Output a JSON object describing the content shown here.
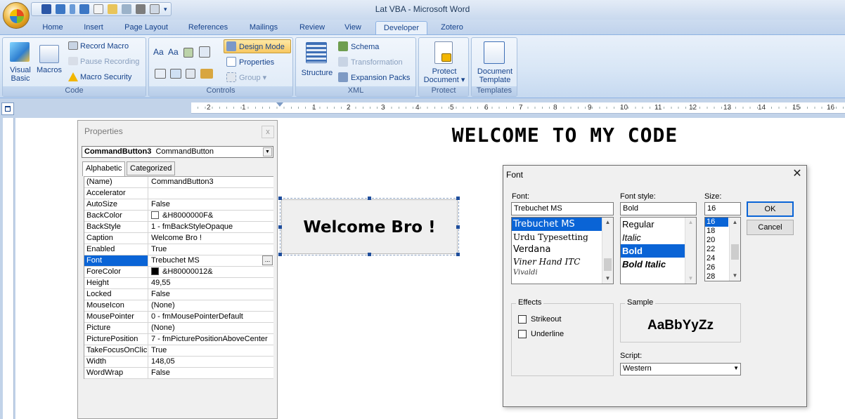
{
  "window": {
    "title": "Lat VBA - Microsoft Word"
  },
  "tabs": [
    "Home",
    "Insert",
    "Page Layout",
    "References",
    "Mailings",
    "Review",
    "View",
    "Developer",
    "Zotero"
  ],
  "active_tab": "Developer",
  "ribbon": {
    "code": {
      "label": "Code",
      "visual_basic": [
        "Visual",
        "Basic"
      ],
      "macros": "Macros",
      "record_macro": "Record Macro",
      "pause_recording": "Pause Recording",
      "macro_security": "Macro Security"
    },
    "controls": {
      "label": "Controls",
      "design_mode": "Design Mode",
      "properties": "Properties",
      "group": "Group"
    },
    "xml": {
      "label": "XML",
      "structure": "Structure",
      "schema": "Schema",
      "transformation": "Transformation",
      "expansion_packs": "Expansion Packs"
    },
    "protect": {
      "label": "Protect",
      "protect_document": [
        "Protect",
        "Document"
      ]
    },
    "templates": {
      "label": "Templates",
      "document_template": [
        "Document",
        "Template"
      ]
    }
  },
  "ruler": {
    "labels": [
      "2",
      "1",
      "1",
      "2",
      "3",
      "4",
      "5",
      "6",
      "7",
      "8",
      "9",
      "10",
      "11",
      "12",
      "13",
      "14",
      "15",
      "16"
    ]
  },
  "properties_panel": {
    "title": "Properties",
    "close": "x",
    "object_name": "CommandButton3",
    "object_type": "CommandButton",
    "tabs": [
      "Alphabetic",
      "Categorized"
    ],
    "active_tab": "Alphabetic",
    "selected_row": "Font",
    "rows": [
      {
        "name": "(Name)",
        "value": "CommandButton3"
      },
      {
        "name": "Accelerator",
        "value": ""
      },
      {
        "name": "AutoSize",
        "value": "False"
      },
      {
        "name": "BackColor",
        "value": "&H8000000F&",
        "swatch": "#ffffff"
      },
      {
        "name": "BackStyle",
        "value": "1 - fmBackStyleOpaque"
      },
      {
        "name": "Caption",
        "value": "Welcome Bro !"
      },
      {
        "name": "Enabled",
        "value": "True"
      },
      {
        "name": "Font",
        "value": "Trebuchet MS"
      },
      {
        "name": "ForeColor",
        "value": "&H80000012&",
        "swatch": "#000000"
      },
      {
        "name": "Height",
        "value": "49,55"
      },
      {
        "name": "Locked",
        "value": "False"
      },
      {
        "name": "MouseIcon",
        "value": "(None)"
      },
      {
        "name": "MousePointer",
        "value": "0 - fmMousePointerDefault"
      },
      {
        "name": "Picture",
        "value": "(None)"
      },
      {
        "name": "PicturePosition",
        "value": "7 - fmPicturePositionAboveCenter"
      },
      {
        "name": "TakeFocusOnClick",
        "value": "True"
      },
      {
        "name": "Width",
        "value": "148,05"
      },
      {
        "name": "WordWrap",
        "value": "False"
      }
    ]
  },
  "document": {
    "heading": "WELCOME TO MY CODE",
    "button_caption": "Welcome Bro !"
  },
  "font_dialog": {
    "title": "Font",
    "font_label": "Font:",
    "font_value": "Trebuchet MS",
    "font_list": [
      "Trebuchet MS",
      "Urdu Typesetting",
      "Verdana",
      "Viner Hand ITC",
      "Vivaldi"
    ],
    "style_label": "Font style:",
    "style_value": "Bold",
    "style_list": [
      "Regular",
      "Italic",
      "Bold",
      "Bold Italic"
    ],
    "size_label": "Size:",
    "size_value": "16",
    "size_list": [
      "16",
      "18",
      "20",
      "22",
      "24",
      "26",
      "28"
    ],
    "ok": "OK",
    "cancel": "Cancel",
    "effects_label": "Effects",
    "strikeout": "Strikeout",
    "underline": "Underline",
    "sample_label": "Sample",
    "sample_text": "AaBbYyZz",
    "script_label": "Script:",
    "script_value": "Western"
  },
  "colors": {
    "selection": "#0a64d6",
    "ribbon_text": "#15428b"
  }
}
